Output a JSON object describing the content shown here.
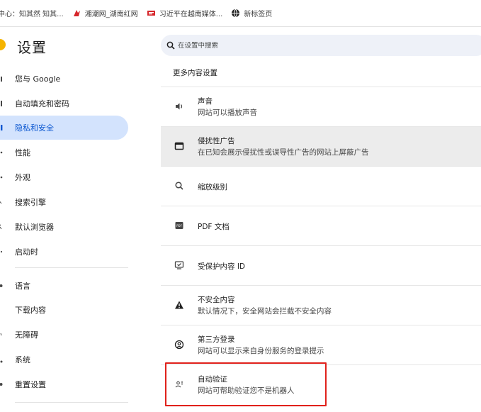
{
  "bookmarks": [
    {
      "label": "中心：知其然 知其...",
      "icon": "none"
    },
    {
      "label": "湘潮网_湖南红网",
      "icon": "red-brand-icon"
    },
    {
      "label": "习近平在越南媒体...",
      "icon": "red-news-icon"
    },
    {
      "label": "新标签页",
      "icon": "globe-icon"
    }
  ],
  "header": {
    "title": "设置",
    "search_placeholder": "在设置中搜索"
  },
  "sidebar": {
    "items": [
      {
        "label": "您与 Google"
      },
      {
        "label": "自动填充和密码"
      },
      {
        "label": "隐私和安全",
        "active": true
      },
      {
        "label": "性能"
      },
      {
        "label": "外观"
      },
      {
        "label": "搜索引擎"
      },
      {
        "label": "默认浏览器"
      },
      {
        "label": "启动时"
      },
      {
        "label": "语言"
      },
      {
        "label": "下载内容"
      },
      {
        "label": "无障碍"
      },
      {
        "label": "系统"
      },
      {
        "label": "重置设置"
      }
    ]
  },
  "main": {
    "section_title": "更多内容设置",
    "rows": [
      {
        "title": "声音",
        "subtitle": "网站可以播放声音",
        "icon": "speaker-icon"
      },
      {
        "title": "侵扰性广告",
        "subtitle": "在已知会展示侵扰性或误导性广告的网站上屏蔽广告",
        "icon": "ad-window-icon"
      },
      {
        "title": "缩放级别",
        "subtitle": "",
        "icon": "zoom-icon"
      },
      {
        "title": "PDF 文档",
        "subtitle": "",
        "icon": "pdf-icon"
      },
      {
        "title": "受保护内容 ID",
        "subtitle": "",
        "icon": "protected-content-icon"
      },
      {
        "title": "不安全内容",
        "subtitle": "默认情况下，安全网站会拦截不安全内容",
        "icon": "warning-icon"
      },
      {
        "title": "第三方登录",
        "subtitle": "网站可以显示来自身份服务的登录提示",
        "icon": "account-circle-icon"
      },
      {
        "title": "自动验证",
        "subtitle": "网站可帮助验证您不是机器人",
        "icon": "auto-verify-icon"
      }
    ]
  },
  "colors": {
    "active_bg": "#d3e3fd",
    "active_text": "#0b57d0",
    "search_bg": "#eef1f8",
    "hover_row": "#ececec",
    "highlight": "#e0211b"
  }
}
